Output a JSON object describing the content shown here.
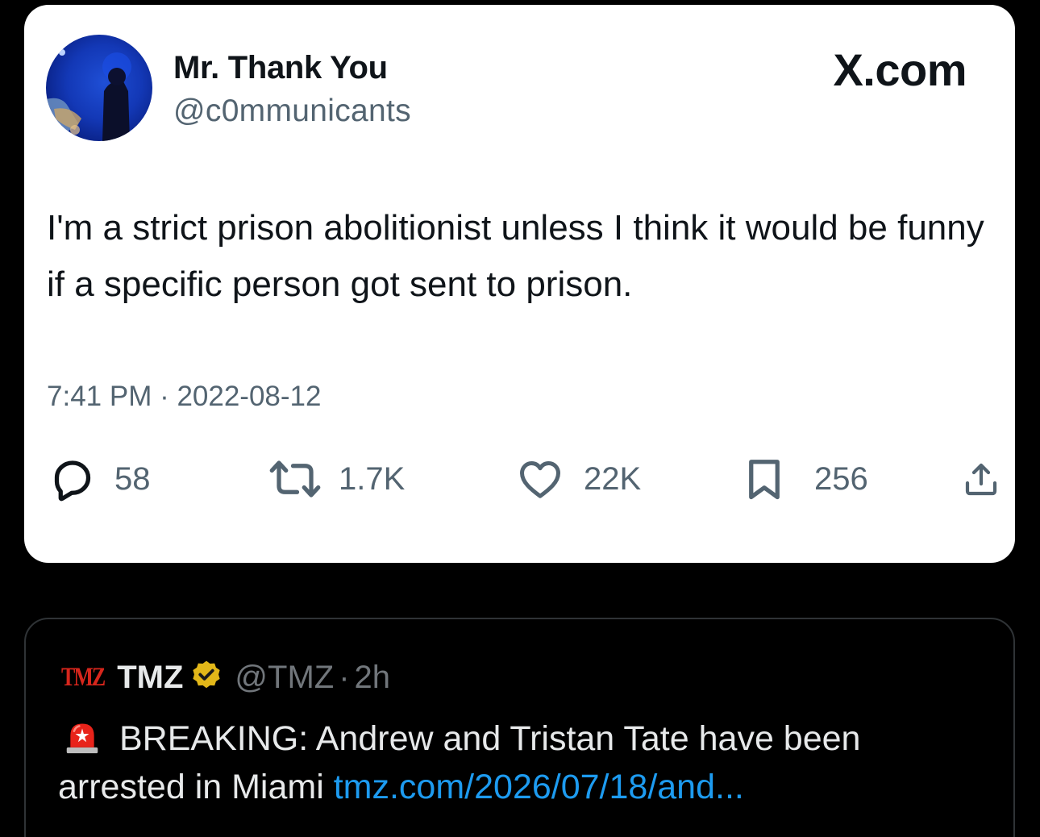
{
  "tweet": {
    "display_name": "Mr. Thank You",
    "handle": "@c0mmunicants",
    "brand": "X.com",
    "text": "I'm a strict prison abolitionist unless I think it would be funny if a specific person got sent to prison.",
    "timestamp": "7:41 PM · 2022-08-12",
    "actions": {
      "replies": "58",
      "reposts": "1.7K",
      "likes": "22K",
      "bookmarks": "256"
    },
    "colors": {
      "text": "#0f1419",
      "secondary": "#536471",
      "card_bg": "#ffffff"
    }
  },
  "quote": {
    "logo": "TMZ",
    "name": "TMZ",
    "handle": "@TMZ",
    "separator": "·",
    "time": "2h",
    "verified_icon": "verified-gold-badge-icon",
    "siren_icon": "rotating-light-emoji-icon",
    "text": "BREAKING: Andrew and Tristan Tate have been arrested in Miami",
    "link": "tmz.com/2026/07/18/and...",
    "colors": {
      "link": "#1d9bf0",
      "verified": "#e2b719",
      "logo": "#d7261c"
    }
  }
}
